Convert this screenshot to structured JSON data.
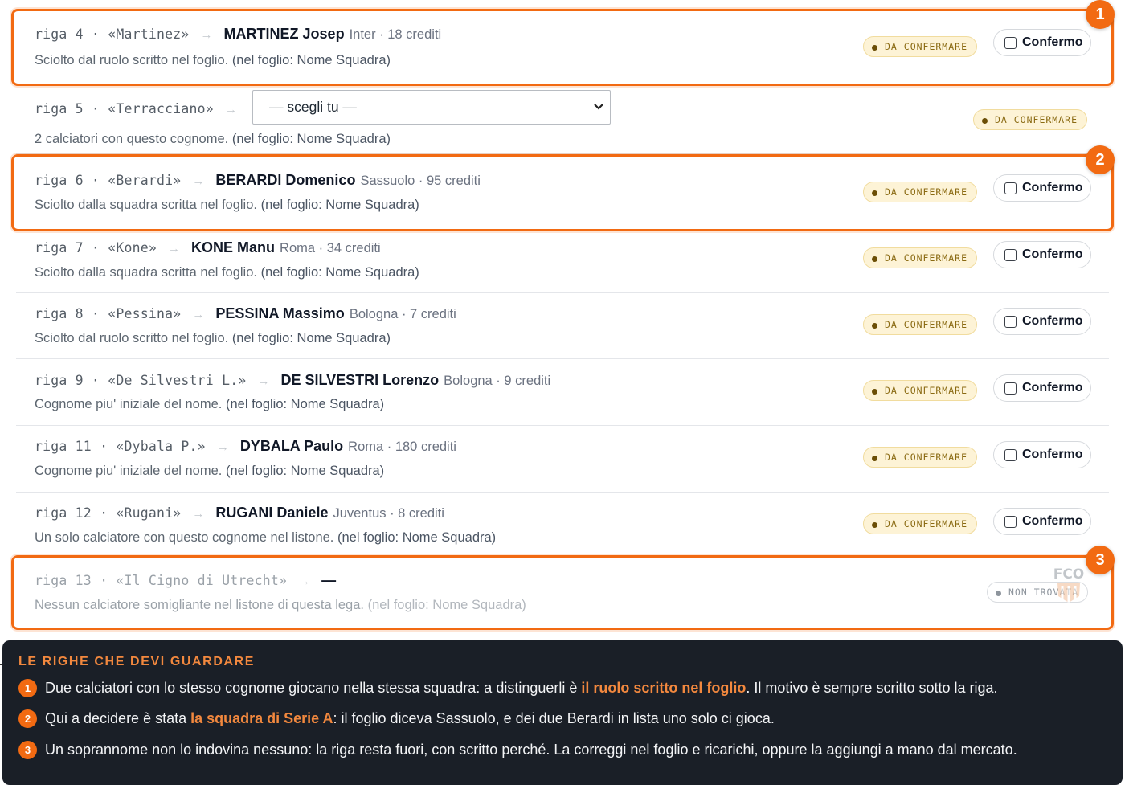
{
  "rows": [
    {
      "riga": "riga 4 · «Martinez»",
      "name": "MARTINEZ Josep",
      "meta": "Inter · 18 crediti",
      "reason": "Sciolto dal ruolo scritto nel foglio.",
      "sheet": "(nel foglio: Nome Squadra)",
      "status": "DA CONFERMARE",
      "confirm": "Confermo"
    },
    {
      "riga": "riga 5 · «Terracciano»",
      "select_value": "— scegli tu —",
      "reason": "2 calciatori con questo cognome.",
      "sheet": "(nel foglio: Nome Squadra)",
      "status": "DA CONFERMARE"
    },
    {
      "riga": "riga 6 · «Berardi»",
      "name": "BERARDI Domenico",
      "meta": "Sassuolo · 95 crediti",
      "reason": "Sciolto dalla squadra scritta nel foglio.",
      "sheet": "(nel foglio: Nome Squadra)",
      "status": "DA CONFERMARE",
      "confirm": "Confermo"
    },
    {
      "riga": "riga 7 · «Kone»",
      "name": "KONE Manu",
      "meta": "Roma · 34 crediti",
      "reason": "Sciolto dalla squadra scritta nel foglio.",
      "sheet": "(nel foglio: Nome Squadra)",
      "status": "DA CONFERMARE",
      "confirm": "Confermo"
    },
    {
      "riga": "riga 8 · «Pessina»",
      "name": "PESSINA Massimo",
      "meta": "Bologna · 7 crediti",
      "reason": "Sciolto dal ruolo scritto nel foglio.",
      "sheet": "(nel foglio: Nome Squadra)",
      "status": "DA CONFERMARE",
      "confirm": "Confermo"
    },
    {
      "riga": "riga 9 · «De Silvestri L.»",
      "name": "DE SILVESTRI Lorenzo",
      "meta": "Bologna · 9 crediti",
      "reason": "Cognome piu' iniziale del nome.",
      "sheet": "(nel foglio: Nome Squadra)",
      "status": "DA CONFERMARE",
      "confirm": "Confermo"
    },
    {
      "riga": "riga 11 · «Dybala P.»",
      "name": "DYBALA Paulo",
      "meta": "Roma · 180 crediti",
      "reason": "Cognome piu' iniziale del nome.",
      "sheet": "(nel foglio: Nome Squadra)",
      "status": "DA CONFERMARE",
      "confirm": "Confermo"
    },
    {
      "riga": "riga 12 · «Rugani»",
      "name": "RUGANI Daniele",
      "meta": "Juventus · 8 crediti",
      "reason": "Un solo calciatore con questo cognome nel listone.",
      "sheet": "(nel foglio: Nome Squadra)",
      "status": "DA CONFERMARE",
      "confirm": "Confermo"
    },
    {
      "riga": "riga 13 · «Il Cigno di Utrecht»",
      "name": "—",
      "reason": "Nessun calciatore somigliante nel listone di questa lega.",
      "sheet": "(nel foglio: Nome Squadra)",
      "status": "NON TROVATA"
    }
  ],
  "arrow": "→",
  "markers": [
    "1",
    "2",
    "3"
  ],
  "watermark": "FCO",
  "panel": {
    "title": "LE RIGHE CHE DEVI GUARDARE",
    "tips": [
      {
        "n": "1",
        "pre": "Due calciatori con lo stesso cognome giocano nella stessa squadra: a distinguerli è ",
        "em": "il ruolo scritto nel foglio",
        "post": ". Il motivo è sempre scritto sotto la riga."
      },
      {
        "n": "2",
        "pre": "Qui a decidere è stata ",
        "em": "la squadra di Serie A",
        "post": ": il foglio diceva Sassuolo, e dei due Berardi in lista uno solo ci gioca."
      },
      {
        "n": "3",
        "pre": "Un soprannome non lo indovina nessuno: la riga resta fuori, con scritto perché. La correggi nel foglio e ricarichi, oppure la aggiungi a mano dal mercato.",
        "em": "",
        "post": ""
      }
    ]
  },
  "colors": {
    "accent": "#f26a12",
    "badge_bg": "#fdf3d6",
    "panel_bg": "#1a1f27"
  }
}
